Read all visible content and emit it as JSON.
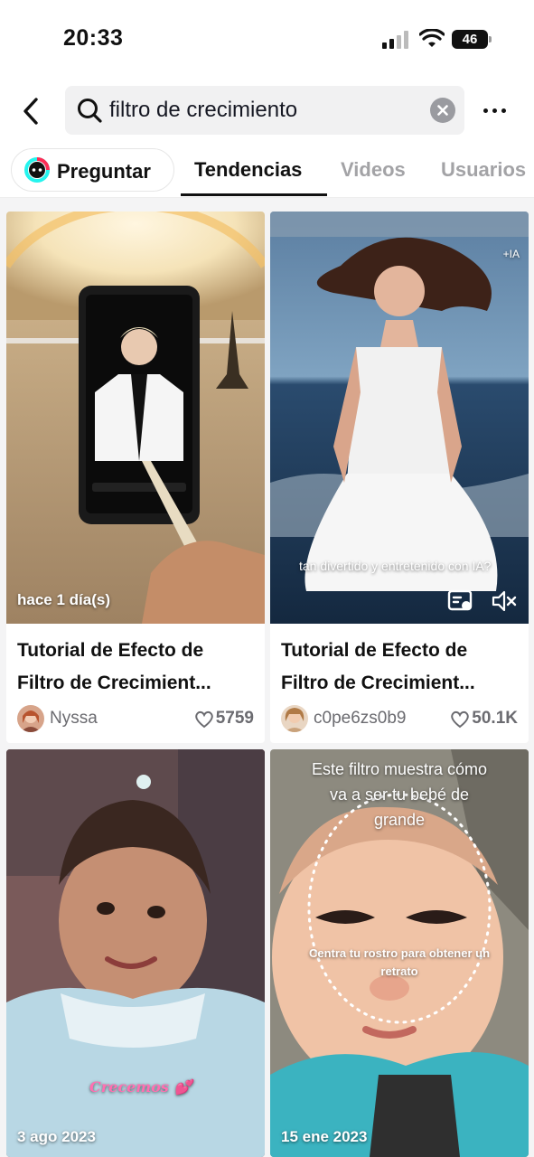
{
  "status_bar": {
    "time": "20:33",
    "battery": "46"
  },
  "search": {
    "query": "filtro de crecimiento"
  },
  "tabs": {
    "ask_label": "Preguntar",
    "items": [
      {
        "label": "Tendencias",
        "active": true
      },
      {
        "label": "Videos",
        "active": false
      },
      {
        "label": "Usuarios",
        "active": false
      }
    ]
  },
  "results": [
    {
      "overlay_date": "hace 1 día(s)",
      "title_line1": "Tutorial de Efecto de",
      "title_line2": "Filtro de Crecimient...",
      "author": "Nyssa",
      "likes": "5759"
    },
    {
      "overlay_caption": "tan divertido y entretenido con IA?",
      "corner_tag": "+IA",
      "title_line1": "Tutorial de Efecto de",
      "title_line2": "Filtro de Crecimient...",
      "author": "c0pe6zs0b9",
      "likes": "50.1K"
    },
    {
      "overlay_caption": "Crecemos 💕",
      "overlay_date": "3 ago 2023"
    },
    {
      "overlay_top": "Este filtro muestra cómo va a ser tu bebé de grande",
      "overlay_top_line1": "Este filtro muestra cómo",
      "overlay_top_line2": "va a ser tu bebé de",
      "overlay_top_line3": "grande",
      "overlay_center_line1": "Centra tu rostro para obtener un",
      "overlay_center_line2": "retrato",
      "overlay_date": "15 ene 2023"
    }
  ],
  "colors": {
    "tab_inactive": "#a3a3a6",
    "accent": "#fe2c55",
    "bg_grid": "#f4f4f5"
  }
}
